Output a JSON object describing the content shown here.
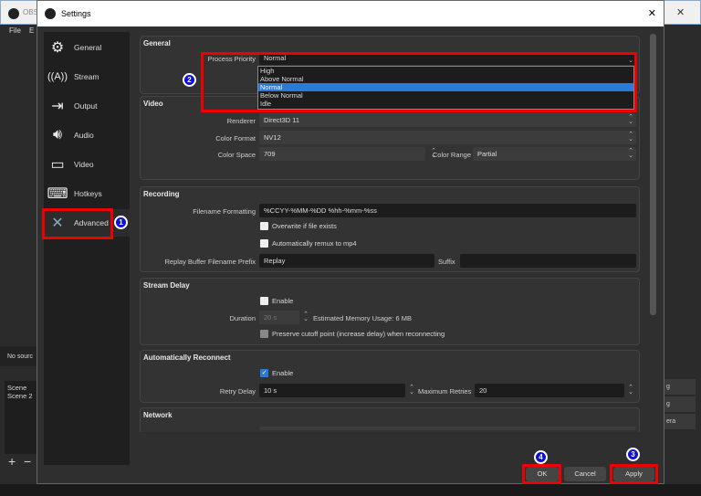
{
  "obs": {
    "title": "OBS",
    "menu_file": "File",
    "menu_edit": "E",
    "no_source": "No sourc",
    "scenes": [
      "Scene",
      "Scene 2"
    ],
    "right_items": [
      "g",
      "g",
      "era"
    ],
    "add": "+",
    "remove": "−",
    "close": "✕"
  },
  "dialog": {
    "title": "Settings",
    "close": "✕"
  },
  "sidebar": {
    "items": [
      {
        "label": "General",
        "icon": "gear-icon"
      },
      {
        "label": "Stream",
        "icon": "antenna-icon"
      },
      {
        "label": "Output",
        "icon": "output-icon"
      },
      {
        "label": "Audio",
        "icon": "speaker-icon"
      },
      {
        "label": "Video",
        "icon": "monitor-icon"
      },
      {
        "label": "Hotkeys",
        "icon": "keyboard-icon"
      },
      {
        "label": "Advanced",
        "icon": "tools-icon"
      }
    ]
  },
  "general": {
    "title": "General",
    "process_priority_label": "Process Priority",
    "process_priority_value": "Normal",
    "options": [
      "High",
      "Above Normal",
      "Normal",
      "Below Normal",
      "Idle"
    ],
    "selected": "Normal"
  },
  "video": {
    "title": "Video",
    "renderer_label": "Renderer",
    "renderer": "Direct3D 11",
    "color_format_label": "Color Format",
    "color_format": "NV12",
    "color_space_label": "Color Space",
    "color_space": "709",
    "color_range_label": "Color Range",
    "color_range": "Partial"
  },
  "recording": {
    "title": "Recording",
    "filename_label": "Filename Formatting",
    "filename": "%CCYY-%MM-%DD %hh-%mm-%ss",
    "overwrite": "Overwrite if file exists",
    "remux": "Automatically remux to mp4",
    "replay_prefix_label": "Replay Buffer Filename Prefix",
    "replay_prefix": "Replay",
    "suffix_label": "Suffix",
    "suffix": ""
  },
  "stream_delay": {
    "title": "Stream Delay",
    "enable": "Enable",
    "duration_label": "Duration",
    "duration": "20 s",
    "memory": "Estimated Memory Usage: 6 MB",
    "preserve": "Preserve cutoff point (increase delay) when reconnecting"
  },
  "reconnect": {
    "title": "Automatically Reconnect",
    "enable": "Enable",
    "retry_delay_label": "Retry Delay",
    "retry_delay": "10 s",
    "max_retries_label": "Maximum Retries",
    "max_retries": "20"
  },
  "network": {
    "title": "Network"
  },
  "buttons": {
    "ok": "OK",
    "cancel": "Cancel",
    "apply": "Apply"
  },
  "annotations": {
    "b1": "1",
    "b2": "2",
    "b3": "3",
    "b4": "4"
  },
  "colors": {
    "highlight": "#e00000",
    "badge": "#1010d8",
    "selection": "#2a7ad8"
  }
}
